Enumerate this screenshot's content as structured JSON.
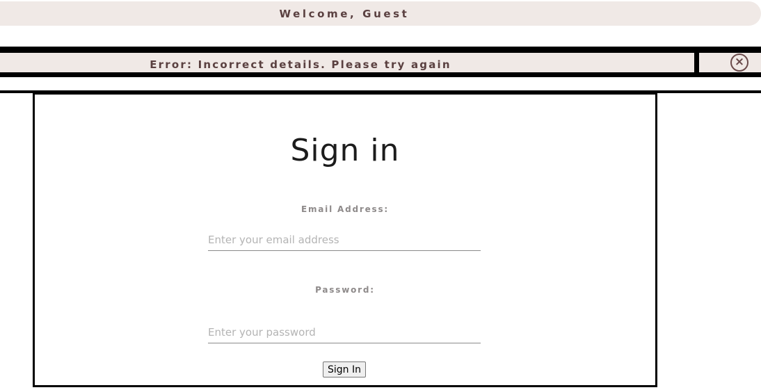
{
  "header": {
    "welcome_text": "Welcome, Guest"
  },
  "alert": {
    "message": "Error: Incorrect details. Please try again",
    "close_icon": "circle-x-icon",
    "close_glyph": "×"
  },
  "signin": {
    "title": "Sign in",
    "email_label": "Email Address:",
    "email_placeholder": "Enter your email address",
    "email_value": "",
    "password_label": "Password:",
    "password_placeholder": "Enter your password",
    "password_value": "",
    "submit_label": "Sign In"
  },
  "colors": {
    "bar_background": "#f0e9e6",
    "accent_text": "#5a4040",
    "border": "#000000",
    "label_text": "#8e8a8a"
  }
}
